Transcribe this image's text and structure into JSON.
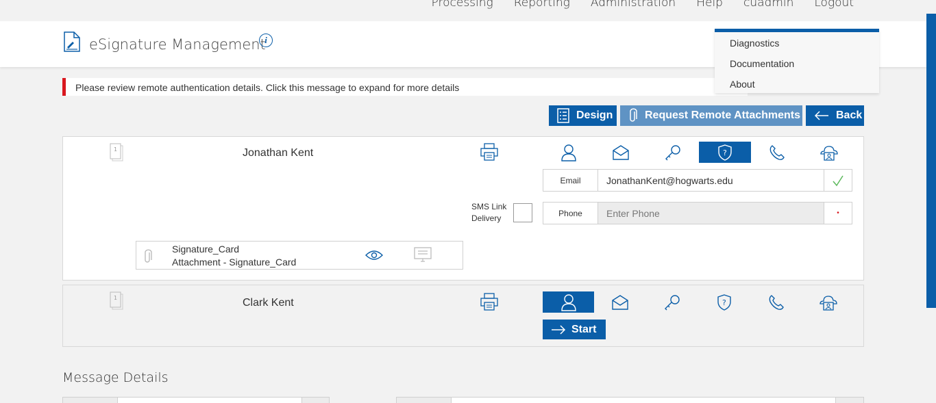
{
  "topnav": {
    "items": [
      "Processing",
      "Reporting",
      "Administration",
      "Help",
      "cuadmin",
      "Logout"
    ]
  },
  "header": {
    "title": "eSignature Management",
    "info": "i"
  },
  "dropdown": {
    "items": [
      "Diagnostics",
      "Documentation",
      "About"
    ]
  },
  "alert": {
    "text": "Please review remote authentication details. Click this message to expand for more details"
  },
  "toolbar": {
    "design_label": "Design",
    "attachments_label": "Request Remote Attachments",
    "back_label": "Back"
  },
  "signers": [
    {
      "name": "Jonathan Kent",
      "email_label": "Email",
      "email_value": "JonathanKent@hogwarts.edu",
      "phone_label": "Phone",
      "phone_placeholder": "Enter Phone",
      "phone_required_mark": "•",
      "sms_label_line1": "SMS Link",
      "sms_label_line2": "Delivery",
      "attachment": {
        "name": "Signature_Card",
        "description": "Attachment - Signature_Card"
      }
    },
    {
      "name": "Clark Kent",
      "start_label": "Start"
    }
  ],
  "message_details": {
    "title": "Message Details"
  },
  "colors": {
    "accent": "#0b5ea8",
    "accent_light": "#5f93c4",
    "alert": "#d9181f",
    "check": "#5cb85c"
  }
}
